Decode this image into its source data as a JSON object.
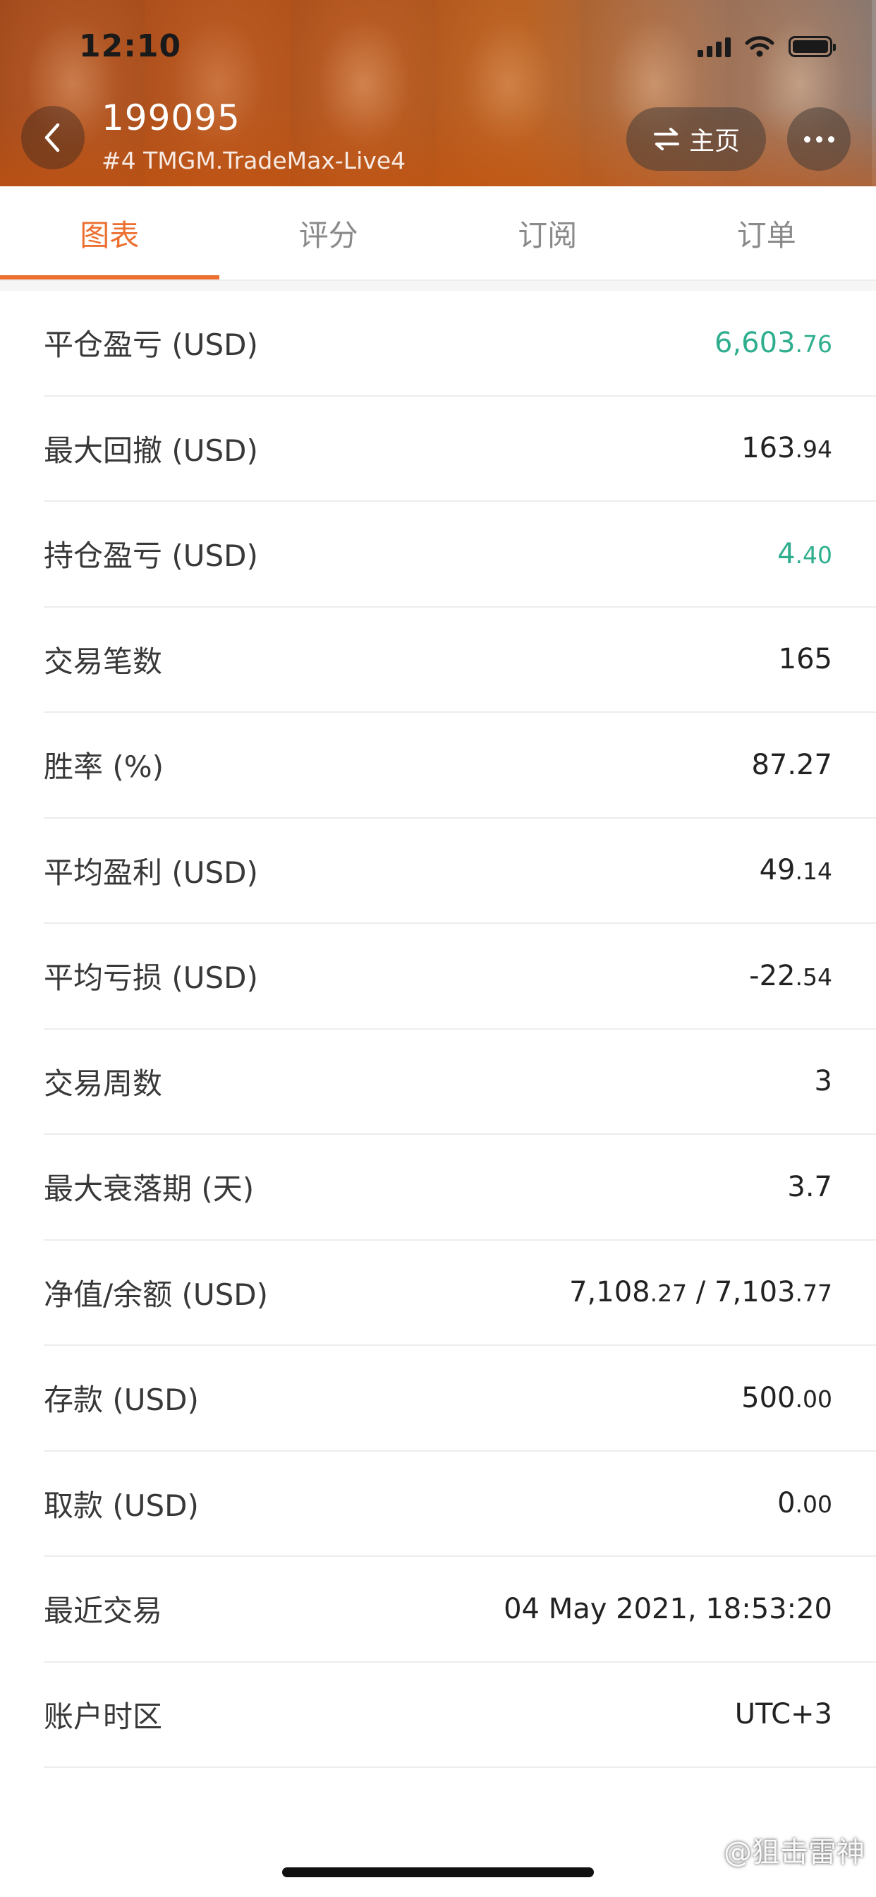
{
  "status_bar": {
    "time": "12:10"
  },
  "header": {
    "title": "199095",
    "subtitle": "#4 TMGM.TradeMax-Live4",
    "home_label": "主页"
  },
  "tabs": [
    {
      "label": "图表",
      "active": true
    },
    {
      "label": "评分",
      "active": false
    },
    {
      "label": "订阅",
      "active": false
    },
    {
      "label": "订单",
      "active": false
    }
  ],
  "stats": {
    "closed_pl": {
      "label": "平仓盈亏 (USD)",
      "int": "6,603",
      "dec": ".76"
    },
    "max_drawdown": {
      "label": "最大回撤 (USD)",
      "int": "163",
      "dec": ".94"
    },
    "floating_pl": {
      "label": "持仓盈亏 (USD)",
      "int": "4",
      "dec": ".40"
    },
    "trades": {
      "label": "交易笔数",
      "value": "165"
    },
    "win_rate": {
      "label": "胜率 (%)",
      "value": "87.27"
    },
    "avg_profit": {
      "label": "平均盈利 (USD)",
      "int": "49",
      "dec": ".14"
    },
    "avg_loss": {
      "label": "平均亏损 (USD)",
      "int": "-22",
      "dec": ".54"
    },
    "weeks": {
      "label": "交易周数",
      "value": "3"
    },
    "max_decline": {
      "label": "最大衰落期 (天)",
      "value": "3.7"
    },
    "equity_balance": {
      "label": "净值/余额 (USD)",
      "equity_int": "7,108",
      "equity_dec": ".27",
      "sep": " / ",
      "balance_int": "7,103",
      "balance_dec": ".77"
    },
    "deposit": {
      "label": "存款 (USD)",
      "int": "500",
      "dec": ".00"
    },
    "withdrawal": {
      "label": "取款 (USD)",
      "int": "0",
      "dec": ".00"
    },
    "last_trade": {
      "label": "最近交易",
      "value": "04 May 2021, 18:53:20"
    },
    "timezone": {
      "label": "账户时区",
      "value": "UTC+3"
    }
  },
  "watermark": "@狙击雷神",
  "colors": {
    "accent": "#ec6f2f",
    "positive": "#2fae8e",
    "header_bg": "#c65a1a"
  }
}
